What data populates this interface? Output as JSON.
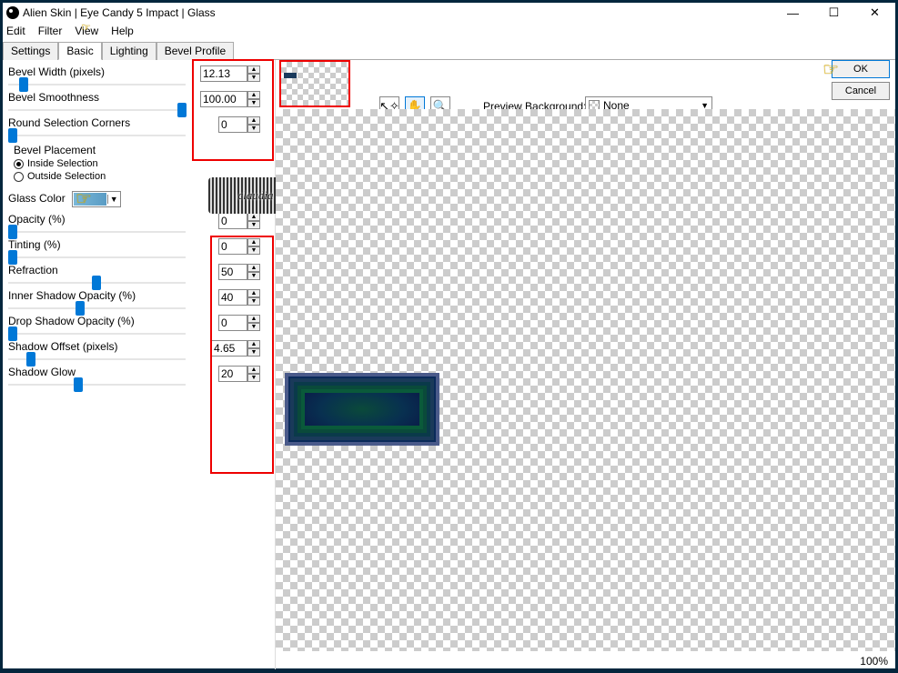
{
  "title": "Alien Skin | Eye Candy 5 Impact | Glass",
  "menu": {
    "edit": "Edit",
    "filter": "Filter",
    "view": "View",
    "help": "Help"
  },
  "tabs": {
    "settings": "Settings",
    "basic": "Basic",
    "lighting": "Lighting",
    "bevel": "Bevel Profile"
  },
  "params": {
    "bevel_width": {
      "label": "Bevel Width (pixels)",
      "value": "12.13"
    },
    "bevel_smoothness": {
      "label": "Bevel Smoothness",
      "value": "100.00"
    },
    "round_corners": {
      "label": "Round Selection Corners",
      "value": "0"
    },
    "placement": {
      "label": "Bevel Placement",
      "inside": "Inside Selection",
      "outside": "Outside Selection"
    },
    "glass_color": {
      "label": "Glass Color"
    },
    "opacity": {
      "label": "Opacity (%)",
      "value": "0"
    },
    "tinting": {
      "label": "Tinting (%)",
      "value": "0"
    },
    "refraction": {
      "label": "Refraction",
      "value": "50"
    },
    "inner_shadow": {
      "label": "Inner Shadow Opacity (%)",
      "value": "40"
    },
    "drop_shadow": {
      "label": "Drop Shadow Opacity (%)",
      "value": "0"
    },
    "shadow_offset": {
      "label": "Shadow Offset (pixels)",
      "value": "4.65"
    },
    "shadow_glow": {
      "label": "Shadow Glow",
      "value": "20"
    }
  },
  "preview": {
    "bg_label": "Preview Background:",
    "bg_value": "None"
  },
  "buttons": {
    "ok": "OK",
    "cancel": "Cancel"
  },
  "watermark": "claudia",
  "zoom": "100%"
}
